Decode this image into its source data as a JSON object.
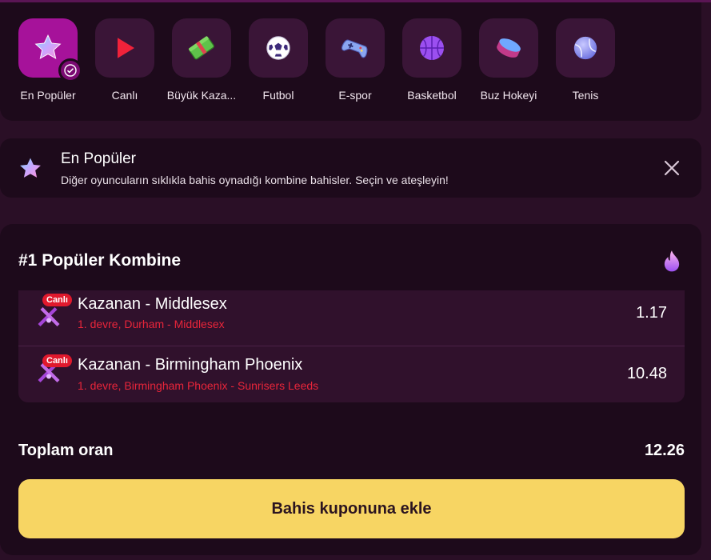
{
  "categories": [
    {
      "label": "En Popüler",
      "icon": "star-icon",
      "active": true
    },
    {
      "label": "Canlı",
      "icon": "play-icon",
      "active": false
    },
    {
      "label": "Büyük Kaza...",
      "icon": "money-icon",
      "active": false
    },
    {
      "label": "Futbol",
      "icon": "soccer-ball-icon",
      "active": false
    },
    {
      "label": "E-spor",
      "icon": "gamepad-icon",
      "active": false
    },
    {
      "label": "Basketbol",
      "icon": "basketball-icon",
      "active": false
    },
    {
      "label": "Buz Hokeyi",
      "icon": "hockey-puck-icon",
      "active": false
    },
    {
      "label": "Tenis",
      "icon": "tennis-ball-icon",
      "active": false
    }
  ],
  "info": {
    "title": "En Popüler",
    "description": "Diğer oyuncuların sıklıkla bahis oynadığı kombine bahisler. Seçin ve ateşleyin!"
  },
  "combo": {
    "title": "#1 Popüler Kombine",
    "bets": [
      {
        "live_badge": "Canlı",
        "name": "Kazanan - Middlesex",
        "detail": "1. devre, Durham - Middlesex",
        "odds": "1.17"
      },
      {
        "live_badge": "Canlı",
        "name": "Kazanan - Birmingham Phoenix",
        "detail": "1. devre, Birmingham Phoenix - Sunrisers Leeds",
        "odds": "10.48"
      }
    ],
    "total_label": "Toplam oran",
    "total_value": "12.26",
    "cta_label": "Bahis kuponuna ekle"
  },
  "colors": {
    "background": "#2a0f26",
    "panel": "#1d0a1b",
    "active_tile": "#a6129a",
    "tile": "#3a1537",
    "live_red": "#e0192d",
    "cta_yellow": "#f7d563"
  }
}
